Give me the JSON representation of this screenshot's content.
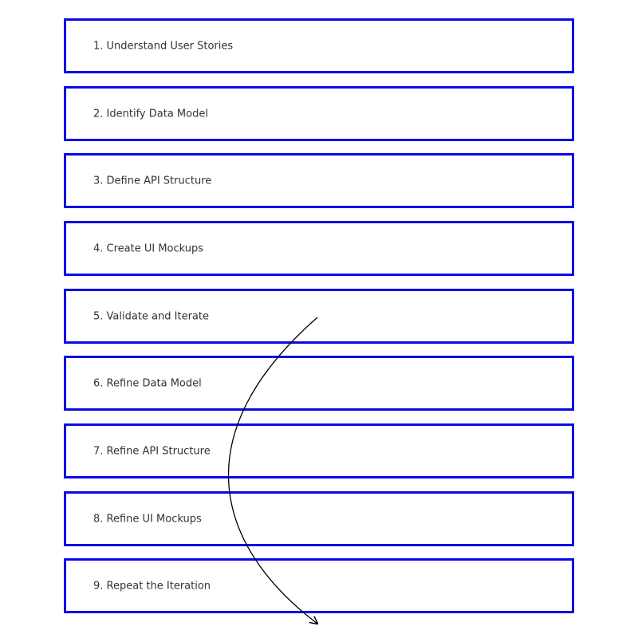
{
  "steps": [
    {
      "label": "1. Understand User Stories"
    },
    {
      "label": "2. Identify Data Model"
    },
    {
      "label": "3. Define API Structure"
    },
    {
      "label": "4. Create UI Mockups"
    },
    {
      "label": "5. Validate and Iterate"
    },
    {
      "label": "6. Refine Data Model"
    },
    {
      "label": "7. Refine API Structure"
    },
    {
      "label": "8. Refine UI Mockups"
    },
    {
      "label": "9. Repeat the Iteration"
    }
  ],
  "colors": {
    "box_border": "#0a0ae6",
    "label_text": "#333333",
    "arrow": "#000000",
    "background": "#ffffff"
  },
  "arrow": {
    "from_step": 5,
    "to_step": 9,
    "icon": "curved-arrow-icon"
  }
}
